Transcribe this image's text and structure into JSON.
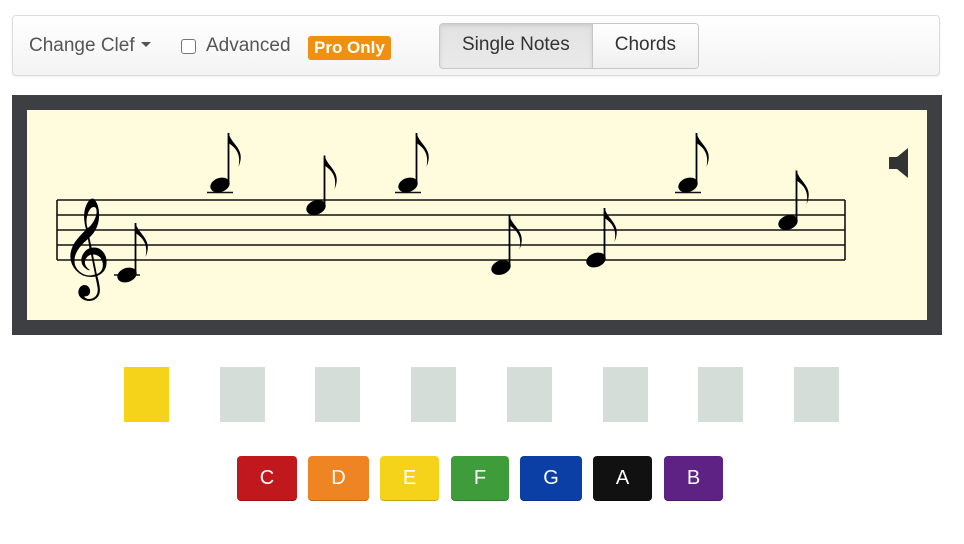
{
  "toolbar": {
    "clef_menu_label": "Change Clef",
    "advanced_label": "Advanced",
    "advanced_checked": false,
    "pro_badge": "Pro Only",
    "mode_tabs": [
      {
        "label": "Single Notes",
        "active": true
      },
      {
        "label": "Chords",
        "active": false
      }
    ]
  },
  "staff": {
    "clef": "treble",
    "clef_glyph": "𝄞",
    "note_duration": "eighth",
    "notes": [
      {
        "pitch": "C4",
        "step": -6
      },
      {
        "pitch": "B5",
        "step": 6
      },
      {
        "pitch": "F5",
        "step": 3
      },
      {
        "pitch": "B5",
        "step": 6
      },
      {
        "pitch": "E4",
        "step": -5
      },
      {
        "pitch": "F4",
        "step": -4
      },
      {
        "pitch": "B5",
        "step": 6
      },
      {
        "pitch": "D5",
        "step": 1
      }
    ],
    "speaker_icon": "speaker-icon"
  },
  "answer_slots": {
    "colors": [
      "#f5d31b",
      "#d5ddd9",
      "#d5ddd9",
      "#d5ddd9",
      "#d5ddd9",
      "#d5ddd9",
      "#d5ddd9",
      "#d5ddd9"
    ],
    "current_index": 0
  },
  "note_buttons": [
    {
      "label": "C",
      "color": "#c0181d"
    },
    {
      "label": "D",
      "color": "#ef8422"
    },
    {
      "label": "E",
      "color": "#f5d31b"
    },
    {
      "label": "F",
      "color": "#3e9c3a"
    },
    {
      "label": "G",
      "color": "#0b3fa6"
    },
    {
      "label": "A",
      "color": "#111111"
    },
    {
      "label": "B",
      "color": "#5e2184"
    }
  ]
}
